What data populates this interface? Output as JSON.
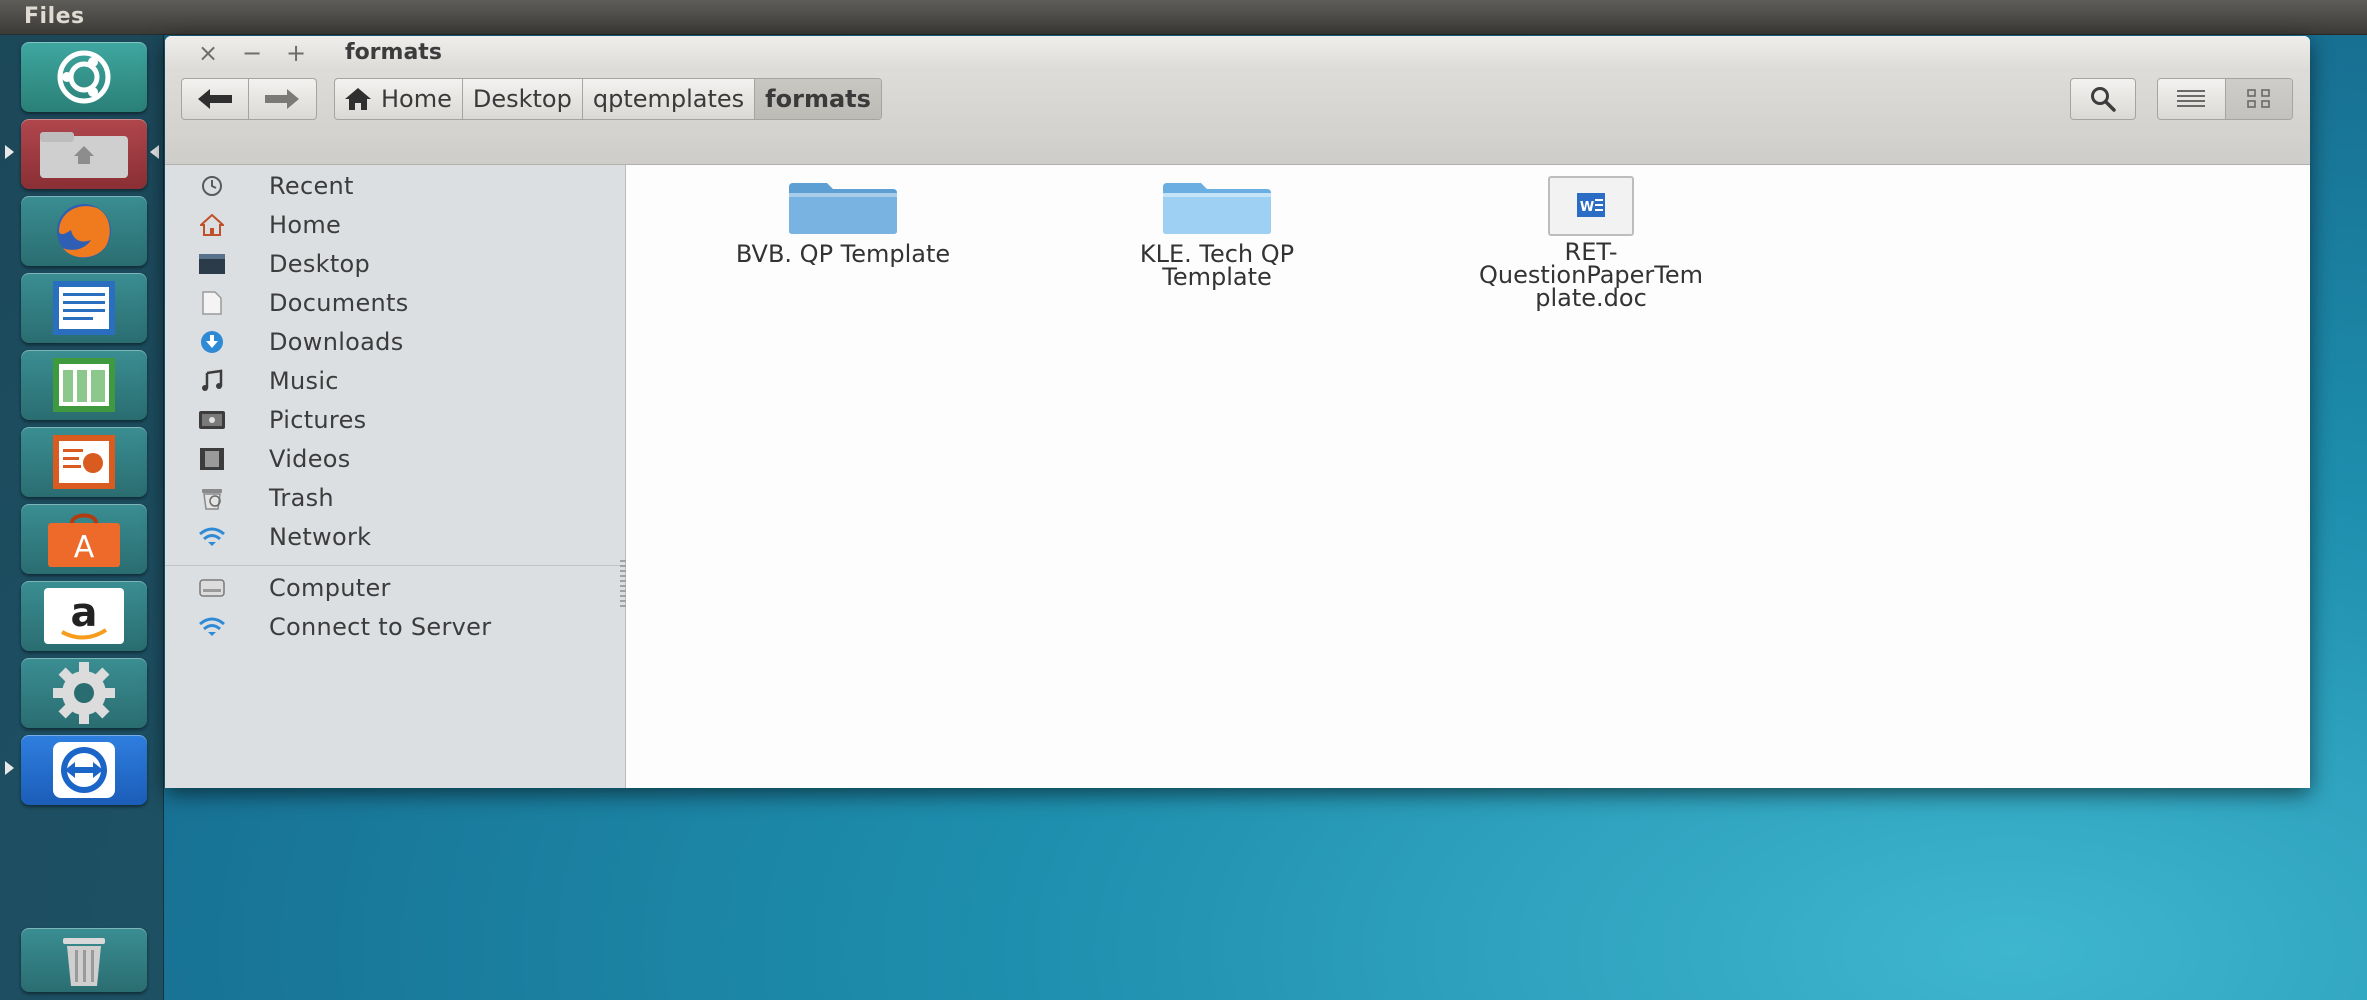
{
  "top_panel": {
    "app_title": "Files"
  },
  "launcher": {
    "items": [
      {
        "name": "dash",
        "icon": "ubuntu-logo-icon"
      },
      {
        "name": "files",
        "icon": "home-folder-icon"
      },
      {
        "name": "firefox",
        "icon": "firefox-icon"
      },
      {
        "name": "writer",
        "icon": "writer-document-icon"
      },
      {
        "name": "calc",
        "icon": "calc-spreadsheet-icon"
      },
      {
        "name": "impress",
        "icon": "impress-presentation-icon"
      },
      {
        "name": "software-center",
        "icon": "shopping-bag-icon"
      },
      {
        "name": "amazon",
        "icon": "amazon-icon"
      },
      {
        "name": "system-settings",
        "icon": "gear-icon"
      },
      {
        "name": "teamviewer",
        "icon": "teamviewer-icon"
      },
      {
        "name": "trash",
        "icon": "trash-icon"
      }
    ]
  },
  "window": {
    "title": "formats",
    "controls": {
      "close": "×",
      "minimize": "−",
      "maximize": "+"
    },
    "nav": {
      "back": "🡐",
      "forward": "🡒"
    },
    "breadcrumbs": [
      {
        "label": "Home",
        "icon": "home-icon"
      },
      {
        "label": "Desktop"
      },
      {
        "label": "qptemplates"
      },
      {
        "label": "formats",
        "active": true
      }
    ]
  },
  "sidebar": {
    "places": [
      {
        "label": "Recent",
        "icon": "clock-icon"
      },
      {
        "label": "Home",
        "icon": "home-icon"
      },
      {
        "label": "Desktop",
        "icon": "desktop-icon"
      },
      {
        "label": "Documents",
        "icon": "document-icon"
      },
      {
        "label": "Downloads",
        "icon": "download-icon"
      },
      {
        "label": "Music",
        "icon": "music-note-icon"
      },
      {
        "label": "Pictures",
        "icon": "camera-icon"
      },
      {
        "label": "Videos",
        "icon": "film-icon"
      },
      {
        "label": "Trash",
        "icon": "trash-icon"
      },
      {
        "label": "Network",
        "icon": "wifi-icon"
      }
    ],
    "devices": [
      {
        "label": "Computer",
        "icon": "drive-icon"
      },
      {
        "label": "Connect to Server",
        "icon": "wifi-icon"
      }
    ]
  },
  "files": [
    {
      "line1": "BVB. QP Template",
      "line2": "",
      "line3": "",
      "type": "folder"
    },
    {
      "line1": "KLE. Tech QP",
      "line2": "Template",
      "line3": "",
      "type": "folder"
    },
    {
      "line1": "RET-",
      "line2": "QuestionPaperTem",
      "line3": "plate.doc",
      "type": "word-document"
    }
  ],
  "colors": {
    "sidebar_bg": "#dcdfe2",
    "content_bg": "#fdfdfd",
    "folder_blue": "#5e9fd3",
    "accent_orange": "#dd4814"
  }
}
